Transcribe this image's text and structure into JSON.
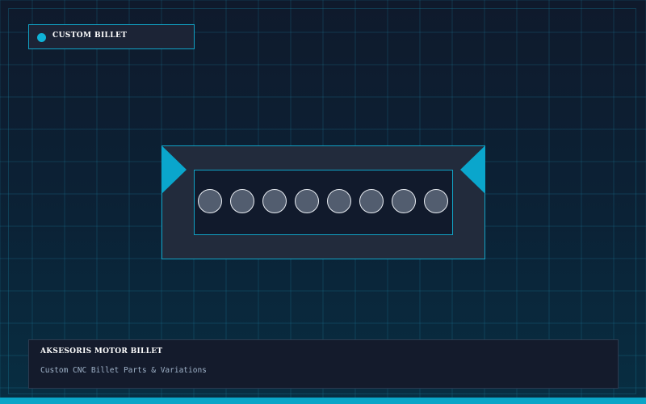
{
  "header": {
    "badge_label": "CUSTOM BILLET"
  },
  "product": {
    "bolt_count": 8
  },
  "caption": {
    "title": "AKSESORIS MOTOR BILLET",
    "subtitle": "Custom CNC Billet Parts & Variations"
  },
  "colors": {
    "accent": "#0aa6cc",
    "panel": "#222b3c",
    "inner_panel": "#111a2c",
    "bolt": "#525d6f"
  }
}
